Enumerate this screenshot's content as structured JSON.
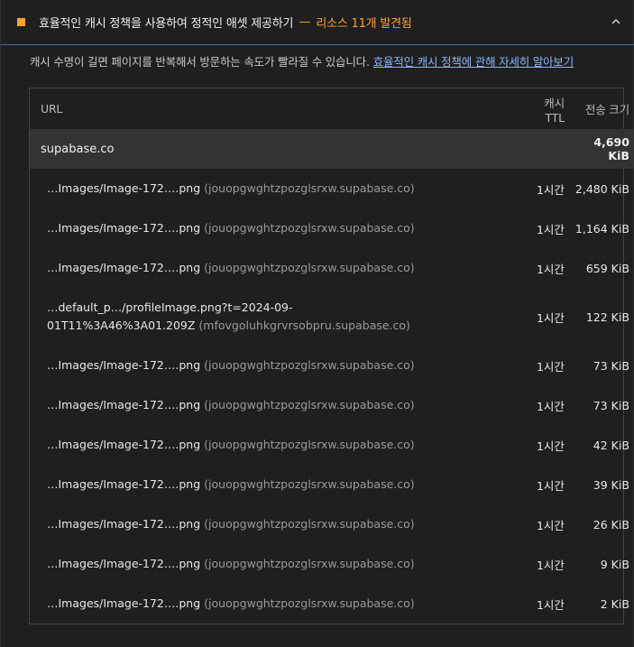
{
  "audit": {
    "title": "효율적인 캐시 정책을 사용하여 정적인 애셋 제공하기",
    "separator": "—",
    "display_value": "리소스 11개 발견됨",
    "description": "캐시 수명이 길면 페이지를 반복해서 방문하는 속도가 빨라질 수 있습니다.",
    "learn_more": "효율적인 캐시 정책에 관해 자세히 알아보기",
    "status_color": "#ffa12c"
  },
  "table": {
    "headers": {
      "url": "URL",
      "ttl": "캐시 TTL",
      "size": "전송 크기"
    },
    "group": {
      "name": "supabase.co",
      "size": "4,690 KiB"
    },
    "rows": [
      {
        "url": "…Images/Image-172….png",
        "host": "(jouopgwghtzpozglsrxw.supabase.co)",
        "ttl": "1시간",
        "size": "2,480 KiB"
      },
      {
        "url": "…Images/Image-172….png",
        "host": "(jouopgwghtzpozglsrxw.supabase.co)",
        "ttl": "1시간",
        "size": "1,164 KiB"
      },
      {
        "url": "…Images/Image-172….png",
        "host": "(jouopgwghtzpozglsrxw.supabase.co)",
        "ttl": "1시간",
        "size": "659 KiB"
      },
      {
        "url": "…default_p…/profileImage.png?t=2024-09-01T11%3A46%3A01.209Z",
        "host": "(mfovgoluhkgrvrsobpru.supabase.co)",
        "ttl": "1시간",
        "size": "122 KiB"
      },
      {
        "url": "…Images/Image-172….png",
        "host": "(jouopgwghtzpozglsrxw.supabase.co)",
        "ttl": "1시간",
        "size": "73 KiB"
      },
      {
        "url": "…Images/Image-172….png",
        "host": "(jouopgwghtzpozglsrxw.supabase.co)",
        "ttl": "1시간",
        "size": "73 KiB"
      },
      {
        "url": "…Images/Image-172….png",
        "host": "(jouopgwghtzpozglsrxw.supabase.co)",
        "ttl": "1시간",
        "size": "42 KiB"
      },
      {
        "url": "…Images/Image-172….png",
        "host": "(jouopgwghtzpozglsrxw.supabase.co)",
        "ttl": "1시간",
        "size": "39 KiB"
      },
      {
        "url": "…Images/Image-172….png",
        "host": "(jouopgwghtzpozglsrxw.supabase.co)",
        "ttl": "1시간",
        "size": "26 KiB"
      },
      {
        "url": "…Images/Image-172….png",
        "host": "(jouopgwghtzpozglsrxw.supabase.co)",
        "ttl": "1시간",
        "size": "9 KiB"
      },
      {
        "url": "…Images/Image-172….png",
        "host": "(jouopgwghtzpozglsrxw.supabase.co)",
        "ttl": "1시간",
        "size": "2 KiB"
      }
    ]
  },
  "icons": {
    "status": "warning-square-icon",
    "toggle": "chevron-up-icon"
  }
}
